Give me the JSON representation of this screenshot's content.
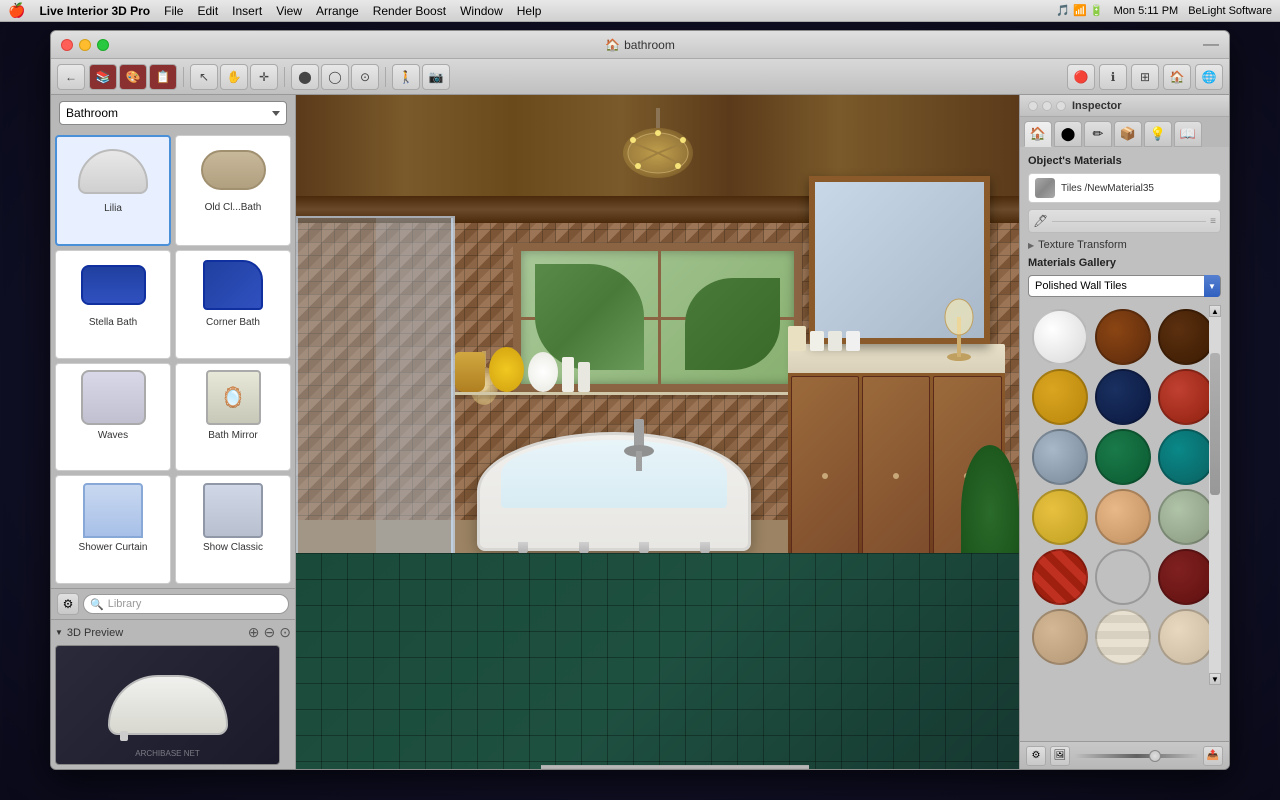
{
  "menubar": {
    "apple": "🍎",
    "app_name": "Live Interior 3D Pro",
    "menus": [
      "File",
      "Edit",
      "Insert",
      "View",
      "Arrange",
      "Render Boost",
      "Window",
      "Help"
    ],
    "right": "Mon 5:11 PM",
    "brand": "BeLight Software"
  },
  "window": {
    "title": "bathroom",
    "title_icon": "🏠"
  },
  "toolbar": {
    "tools": [
      "cursor",
      "hand",
      "crosshair",
      "circle",
      "circle-fill",
      "circle-dash",
      "person",
      "camera"
    ]
  },
  "left_panel": {
    "category": "Bathroom",
    "items": [
      {
        "id": "lilia",
        "label": "Lilia",
        "selected": true
      },
      {
        "id": "old-bath",
        "label": "Old Cl...Bath"
      },
      {
        "id": "stella",
        "label": "Stella Bath"
      },
      {
        "id": "corner-bath",
        "label": "Corner Bath"
      },
      {
        "id": "waves",
        "label": "Waves"
      },
      {
        "id": "bath-mirror",
        "label": "Bath Mirror"
      },
      {
        "id": "shower-curtain",
        "label": "Shower Curtain"
      },
      {
        "id": "show-classic",
        "label": "Show Classic"
      }
    ],
    "search_placeholder": "Library"
  },
  "preview": {
    "label": "3D Preview",
    "watermark": "ARCHIBASE    NET"
  },
  "inspector": {
    "title": "Inspector",
    "tabs": [
      "house",
      "circle",
      "pencil",
      "box",
      "bulb",
      "book"
    ],
    "objects_materials": "Object's Materials",
    "material_name": "Tiles /NewMaterial35",
    "texture_transform": "Texture Transform",
    "materials_gallery_label": "Materials Gallery",
    "gallery_dropdown": "Polished Wall Tiles",
    "swatches": [
      {
        "class": "sw-white",
        "label": "white sphere"
      },
      {
        "class": "sw-brown",
        "label": "brown sphere"
      },
      {
        "class": "sw-dark-brown",
        "label": "dark brown sphere"
      },
      {
        "class": "sw-gold",
        "label": "gold sphere"
      },
      {
        "class": "sw-navy",
        "label": "navy sphere"
      },
      {
        "class": "sw-rust",
        "label": "rust sphere"
      },
      {
        "class": "sw-gray",
        "label": "gray sphere"
      },
      {
        "class": "sw-green",
        "label": "green sphere"
      },
      {
        "class": "sw-teal",
        "label": "teal sphere"
      },
      {
        "class": "sw-yellow",
        "label": "yellow sphere"
      },
      {
        "class": "sw-peach",
        "label": "peach sphere"
      },
      {
        "class": "sw-sage",
        "label": "sage sphere"
      },
      {
        "class": "sw-red-tile",
        "label": "red tile"
      },
      {
        "class": "sw-blue-tile",
        "label": "blue tile"
      },
      {
        "class": "sw-maroon",
        "label": "maroon sphere"
      },
      {
        "class": "sw-tan",
        "label": "tan sphere"
      },
      {
        "class": "sw-cream-tile",
        "label": "cream tile"
      },
      {
        "class": "sw-beige",
        "label": "beige sphere"
      }
    ]
  }
}
